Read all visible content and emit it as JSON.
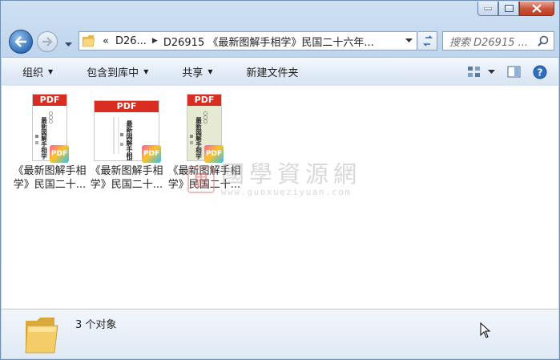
{
  "window": {
    "minimize_icon": "minimize-icon",
    "maximize_icon": "maximize-icon",
    "close_icon": "close-icon"
  },
  "address": {
    "overflow_marker": "«",
    "segments": [
      "D26...",
      "D26915 《最新图解手相学》民国二十六年..."
    ],
    "search_placeholder": "搜索 D26915 ..."
  },
  "toolbar": {
    "organize": "组织",
    "include_in_library": "包含到库中",
    "share": "共享",
    "new_folder": "新建文件夹"
  },
  "files": [
    {
      "name_line1": "《最新图解手相",
      "name_line2": "学》民国二十...",
      "pdf_label": "PDF",
      "badge": "PDF",
      "cover_title": "最新図解手相学",
      "thumb_bg": "#ffffff"
    },
    {
      "name_line1": "《最新图解手相",
      "name_line2": "学》民国二十...",
      "pdf_label": "PDF",
      "badge": "PDF",
      "cover_title": "最新図解手相学",
      "thumb_bg": "#ffffff"
    },
    {
      "name_line1": "《最新图解手相",
      "name_line2": "学》民国二十...",
      "pdf_label": "PDF",
      "badge": "PDF",
      "cover_title": "最新図解手相学",
      "thumb_bg": "#e7ead2"
    }
  ],
  "watermark": {
    "seal": "思",
    "cn": "國學資源網",
    "en": "www.guoxueziyuan.com"
  },
  "status": {
    "count_text": "3 个对象"
  }
}
